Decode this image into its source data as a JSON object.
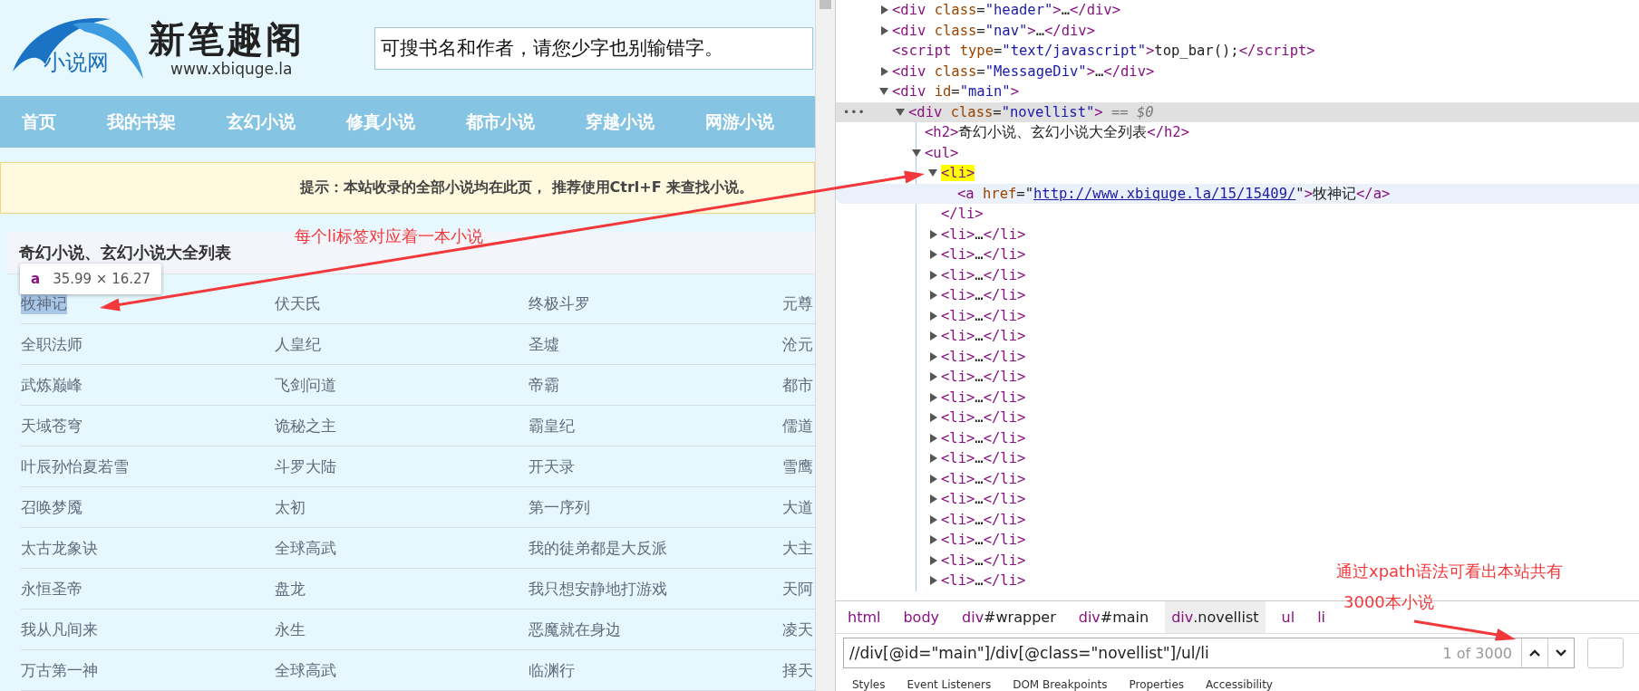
{
  "site": {
    "logo": {
      "tagline": "小说网",
      "name": "新笔趣阁",
      "url": "www.xbiquge.la"
    },
    "search": {
      "placeholder": "可搜书名和作者，请您少字也别输错字。"
    },
    "nav": [
      "首页",
      "我的书架",
      "玄幻小说",
      "修真小说",
      "都市小说",
      "穿越小说",
      "网游小说"
    ],
    "notice": "提示：本站收录的全部小说均在此页， 推荐使用Ctrl+F 来查找小说。",
    "list_title": "奇幻小说、玄幻小说大全列表",
    "tooltip": {
      "tag": "a",
      "size": "35.99 × 16.27"
    },
    "novels": [
      {
        "title": "牧神记",
        "highlighted": true
      },
      {
        "title": "伏天氏",
        "highlighted": false
      },
      {
        "title": "终极斗罗",
        "highlighted": false
      },
      {
        "title": "元尊",
        "highlighted": false
      },
      {
        "title": "全职法师",
        "highlighted": false
      },
      {
        "title": "人皇纪",
        "highlighted": false
      },
      {
        "title": "圣墟",
        "highlighted": false
      },
      {
        "title": "沧元",
        "highlighted": false
      },
      {
        "title": "武炼巅峰",
        "highlighted": false
      },
      {
        "title": "飞剑问道",
        "highlighted": false
      },
      {
        "title": "帝霸",
        "highlighted": false
      },
      {
        "title": "都市",
        "highlighted": false
      },
      {
        "title": "天域苍穹",
        "highlighted": false
      },
      {
        "title": "诡秘之主",
        "highlighted": false
      },
      {
        "title": "霸皇纪",
        "highlighted": false
      },
      {
        "title": "儒道",
        "highlighted": false
      },
      {
        "title": "叶辰孙怡夏若雪",
        "highlighted": false
      },
      {
        "title": "斗罗大陆",
        "highlighted": false
      },
      {
        "title": "开天录",
        "highlighted": false
      },
      {
        "title": "雪鹰",
        "highlighted": false
      },
      {
        "title": "召唤梦魇",
        "highlighted": false
      },
      {
        "title": "太初",
        "highlighted": false
      },
      {
        "title": "第一序列",
        "highlighted": false
      },
      {
        "title": "大道",
        "highlighted": false
      },
      {
        "title": "太古龙象诀",
        "highlighted": false
      },
      {
        "title": "全球高武",
        "highlighted": false
      },
      {
        "title": "我的徒弟都是大反派",
        "highlighted": false
      },
      {
        "title": "大主",
        "highlighted": false
      },
      {
        "title": "永恒圣帝",
        "highlighted": false
      },
      {
        "title": "盘龙",
        "highlighted": false
      },
      {
        "title": "我只想安静地打游戏",
        "highlighted": false
      },
      {
        "title": "天阿",
        "highlighted": false
      },
      {
        "title": "我从凡间来",
        "highlighted": false
      },
      {
        "title": "永生",
        "highlighted": false
      },
      {
        "title": "恶魔就在身边",
        "highlighted": false
      },
      {
        "title": "凌天",
        "highlighted": false
      },
      {
        "title": "万古第一神",
        "highlighted": false
      },
      {
        "title": "全球高武",
        "highlighted": false
      },
      {
        "title": "临渊行",
        "highlighted": false
      },
      {
        "title": "择天",
        "highlighted": false
      }
    ]
  },
  "devtools": {
    "tree": [
      {
        "tokens": [
          {
            "kind": "tag",
            "text": "<div"
          },
          {
            "kind": "attr",
            "text": " class"
          },
          {
            "kind": "plain",
            "text": "="
          },
          {
            "kind": "value",
            "text": "\"header\""
          },
          {
            "kind": "tag",
            "text": ">"
          },
          {
            "kind": "plain",
            "text": "…"
          },
          {
            "kind": "tag",
            "text": "</div>"
          }
        ],
        "expanded": false,
        "selected": false,
        "hovered": false
      },
      {
        "tokens": [
          {
            "kind": "tag",
            "text": "<div"
          },
          {
            "kind": "attr",
            "text": " class"
          },
          {
            "kind": "plain",
            "text": "="
          },
          {
            "kind": "value",
            "text": "\"nav\""
          },
          {
            "kind": "tag",
            "text": ">"
          },
          {
            "kind": "plain",
            "text": "…"
          },
          {
            "kind": "tag",
            "text": "</div>"
          }
        ],
        "expanded": false,
        "selected": false,
        "hovered": false
      },
      {
        "tokens": [
          {
            "kind": "tag",
            "text": "<script"
          },
          {
            "kind": "attr",
            "text": " type"
          },
          {
            "kind": "plain",
            "text": "="
          },
          {
            "kind": "value",
            "text": "\"text/javascript\""
          },
          {
            "kind": "tag",
            "text": ">"
          },
          {
            "kind": "plain",
            "text": "top_bar();"
          },
          {
            "kind": "tag",
            "text": "</script>"
          }
        ],
        "selected": false,
        "hovered": false
      },
      {
        "tokens": [
          {
            "kind": "tag",
            "text": "<div"
          },
          {
            "kind": "attr",
            "text": " class"
          },
          {
            "kind": "plain",
            "text": "="
          },
          {
            "kind": "value",
            "text": "\"MessageDiv\""
          },
          {
            "kind": "tag",
            "text": ">"
          },
          {
            "kind": "plain",
            "text": "…"
          },
          {
            "kind": "tag",
            "text": "</div>"
          }
        ],
        "expanded": false,
        "selected": false,
        "hovered": false
      },
      {
        "tokens": [
          {
            "kind": "tag",
            "text": "<div"
          },
          {
            "kind": "attr",
            "text": " id"
          },
          {
            "kind": "plain",
            "text": "="
          },
          {
            "kind": "value",
            "text": "\"main\""
          },
          {
            "kind": "tag",
            "text": ">"
          }
        ],
        "expanded": true,
        "selected": false,
        "hovered": false,
        "children": [
          {
            "tokens": [
              {
                "kind": "tag",
                "text": "<div"
              },
              {
                "kind": "attr",
                "text": " class"
              },
              {
                "kind": "plain",
                "text": "="
              },
              {
                "kind": "value",
                "text": "\"novellist\""
              },
              {
                "kind": "tag",
                "text": ">"
              },
              {
                "kind": "hint",
                "text": " == $0"
              }
            ],
            "gutter": "•••",
            "expanded": true,
            "selected": true,
            "hovered": false,
            "children": [
              {
                "tokens": [
                  {
                    "kind": "tag",
                    "text": "<h2>"
                  },
                  {
                    "kind": "plain",
                    "text": "奇幻小说、玄幻小说大全列表"
                  },
                  {
                    "kind": "tag",
                    "text": "</h2>"
                  }
                ],
                "selected": false,
                "hovered": false
              },
              {
                "tokens": [
                  {
                    "kind": "tag",
                    "text": "<ul>"
                  }
                ],
                "expanded": true,
                "selected": false,
                "hovered": false,
                "children": [
                  {
                    "tokens": [
                      {
                        "kind": "mark",
                        "text": "<li>"
                      }
                    ],
                    "expanded": true,
                    "selected": false,
                    "hovered": false,
                    "closing": [
                      {
                        "kind": "tag",
                        "text": "</li>"
                      }
                    ],
                    "children": [
                      {
                        "tokens": [
                          {
                            "kind": "tag",
                            "text": "<a"
                          },
                          {
                            "kind": "attr",
                            "text": " href"
                          },
                          {
                            "kind": "plain",
                            "text": "=\""
                          },
                          {
                            "kind": "link",
                            "text": "http://www.xbiquge.la/15/15409/"
                          },
                          {
                            "kind": "plain",
                            "text": "\""
                          },
                          {
                            "kind": "tag",
                            "text": ">"
                          },
                          {
                            "kind": "plain",
                            "text": "牧神记"
                          },
                          {
                            "kind": "tag",
                            "text": "</a>"
                          }
                        ],
                        "selected": false,
                        "hovered": true
                      }
                    ]
                  },
                  {
                    "tokens": [
                      {
                        "kind": "tag",
                        "text": "<li>"
                      },
                      {
                        "kind": "plain",
                        "text": "…"
                      },
                      {
                        "kind": "tag",
                        "text": "</li>"
                      }
                    ],
                    "expanded": false,
                    "selected": false,
                    "hovered": false
                  },
                  {
                    "tokens": [
                      {
                        "kind": "tag",
                        "text": "<li>"
                      },
                      {
                        "kind": "plain",
                        "text": "…"
                      },
                      {
                        "kind": "tag",
                        "text": "</li>"
                      }
                    ],
                    "expanded": false,
                    "selected": false,
                    "hovered": false
                  },
                  {
                    "tokens": [
                      {
                        "kind": "tag",
                        "text": "<li>"
                      },
                      {
                        "kind": "plain",
                        "text": "…"
                      },
                      {
                        "kind": "tag",
                        "text": "</li>"
                      }
                    ],
                    "expanded": false,
                    "selected": false,
                    "hovered": false
                  },
                  {
                    "tokens": [
                      {
                        "kind": "tag",
                        "text": "<li>"
                      },
                      {
                        "kind": "plain",
                        "text": "…"
                      },
                      {
                        "kind": "tag",
                        "text": "</li>"
                      }
                    ],
                    "expanded": false,
                    "selected": false,
                    "hovered": false
                  },
                  {
                    "tokens": [
                      {
                        "kind": "tag",
                        "text": "<li>"
                      },
                      {
                        "kind": "plain",
                        "text": "…"
                      },
                      {
                        "kind": "tag",
                        "text": "</li>"
                      }
                    ],
                    "expanded": false,
                    "selected": false,
                    "hovered": false
                  },
                  {
                    "tokens": [
                      {
                        "kind": "tag",
                        "text": "<li>"
                      },
                      {
                        "kind": "plain",
                        "text": "…"
                      },
                      {
                        "kind": "tag",
                        "text": "</li>"
                      }
                    ],
                    "expanded": false,
                    "selected": false,
                    "hovered": false
                  },
                  {
                    "tokens": [
                      {
                        "kind": "tag",
                        "text": "<li>"
                      },
                      {
                        "kind": "plain",
                        "text": "…"
                      },
                      {
                        "kind": "tag",
                        "text": "</li>"
                      }
                    ],
                    "expanded": false,
                    "selected": false,
                    "hovered": false
                  },
                  {
                    "tokens": [
                      {
                        "kind": "tag",
                        "text": "<li>"
                      },
                      {
                        "kind": "plain",
                        "text": "…"
                      },
                      {
                        "kind": "tag",
                        "text": "</li>"
                      }
                    ],
                    "expanded": false,
                    "selected": false,
                    "hovered": false
                  },
                  {
                    "tokens": [
                      {
                        "kind": "tag",
                        "text": "<li>"
                      },
                      {
                        "kind": "plain",
                        "text": "…"
                      },
                      {
                        "kind": "tag",
                        "text": "</li>"
                      }
                    ],
                    "expanded": false,
                    "selected": false,
                    "hovered": false
                  },
                  {
                    "tokens": [
                      {
                        "kind": "tag",
                        "text": "<li>"
                      },
                      {
                        "kind": "plain",
                        "text": "…"
                      },
                      {
                        "kind": "tag",
                        "text": "</li>"
                      }
                    ],
                    "expanded": false,
                    "selected": false,
                    "hovered": false
                  },
                  {
                    "tokens": [
                      {
                        "kind": "tag",
                        "text": "<li>"
                      },
                      {
                        "kind": "plain",
                        "text": "…"
                      },
                      {
                        "kind": "tag",
                        "text": "</li>"
                      }
                    ],
                    "expanded": false,
                    "selected": false,
                    "hovered": false
                  },
                  {
                    "tokens": [
                      {
                        "kind": "tag",
                        "text": "<li>"
                      },
                      {
                        "kind": "plain",
                        "text": "…"
                      },
                      {
                        "kind": "tag",
                        "text": "</li>"
                      }
                    ],
                    "expanded": false,
                    "selected": false,
                    "hovered": false
                  },
                  {
                    "tokens": [
                      {
                        "kind": "tag",
                        "text": "<li>"
                      },
                      {
                        "kind": "plain",
                        "text": "…"
                      },
                      {
                        "kind": "tag",
                        "text": "</li>"
                      }
                    ],
                    "expanded": false,
                    "selected": false,
                    "hovered": false
                  },
                  {
                    "tokens": [
                      {
                        "kind": "tag",
                        "text": "<li>"
                      },
                      {
                        "kind": "plain",
                        "text": "…"
                      },
                      {
                        "kind": "tag",
                        "text": "</li>"
                      }
                    ],
                    "expanded": false,
                    "selected": false,
                    "hovered": false
                  },
                  {
                    "tokens": [
                      {
                        "kind": "tag",
                        "text": "<li>"
                      },
                      {
                        "kind": "plain",
                        "text": "…"
                      },
                      {
                        "kind": "tag",
                        "text": "</li>"
                      }
                    ],
                    "expanded": false,
                    "selected": false,
                    "hovered": false
                  },
                  {
                    "tokens": [
                      {
                        "kind": "tag",
                        "text": "<li>"
                      },
                      {
                        "kind": "plain",
                        "text": "…"
                      },
                      {
                        "kind": "tag",
                        "text": "</li>"
                      }
                    ],
                    "expanded": false,
                    "selected": false,
                    "hovered": false
                  },
                  {
                    "tokens": [
                      {
                        "kind": "tag",
                        "text": "<li>"
                      },
                      {
                        "kind": "plain",
                        "text": "…"
                      },
                      {
                        "kind": "tag",
                        "text": "</li>"
                      }
                    ],
                    "expanded": false,
                    "selected": false,
                    "hovered": false
                  },
                  {
                    "tokens": [
                      {
                        "kind": "tag",
                        "text": "<li>"
                      },
                      {
                        "kind": "plain",
                        "text": "…"
                      },
                      {
                        "kind": "tag",
                        "text": "</li>"
                      }
                    ],
                    "expanded": false,
                    "selected": false,
                    "hovered": false
                  }
                ]
              }
            ]
          }
        ]
      }
    ],
    "breadcrumbs": [
      {
        "tag": "html",
        "selected": false
      },
      {
        "tag": "body",
        "selected": false
      },
      {
        "tag": "div",
        "suffix": "#wrapper",
        "selected": false
      },
      {
        "tag": "div",
        "suffix": "#main",
        "selected": false
      },
      {
        "tag": "div",
        "suffix": ".novellist",
        "selected": true
      },
      {
        "tag": "ul",
        "selected": false
      },
      {
        "tag": "li",
        "selected": false
      }
    ],
    "search": {
      "value": "//div[@id=\"main\"]/div[@class=\"novellist\"]/ul/li",
      "count": "1 of 3000"
    },
    "tabs": [
      "Styles",
      "Event Listeners",
      "DOM Breakpoints",
      "Properties",
      "Accessibility"
    ]
  },
  "annotations": [
    {
      "lines": [
        "每个li标签对应着一本小说"
      ]
    },
    {
      "lines": [
        "通过xpath语法可看出本站共有",
        "3000本小说"
      ]
    }
  ]
}
